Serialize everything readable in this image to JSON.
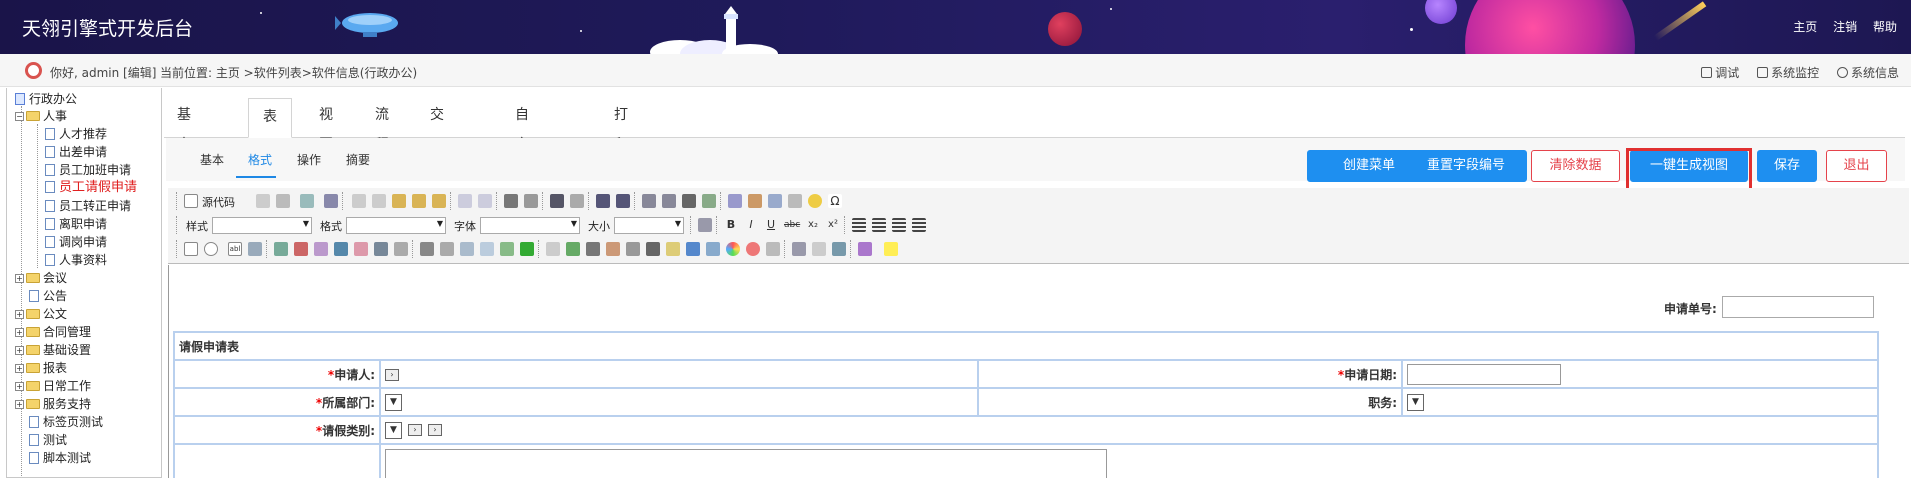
{
  "header": {
    "app_title": "天翎引擎式开发后台",
    "nav": [
      "主页",
      "注销",
      "帮助"
    ]
  },
  "infobar": {
    "greeting": "你好, admin [编辑]",
    "location": "当前位置: 主页 >软件列表>软件信息(行政办公)",
    "tools": [
      "调试",
      "系统监控",
      "系统信息"
    ]
  },
  "tree": {
    "root": "行政办公",
    "hr": "人事",
    "hr_items": [
      "人才推荐",
      "出差申请",
      "员工加班申请",
      "员工请假申请",
      "员工转正申请",
      "离职申请",
      "调岗申请",
      "人事资料"
    ],
    "active_item": "员工请假申请",
    "groups": [
      "会议",
      "公告",
      "公文",
      "合同管理",
      "基础设置",
      "报表",
      "日常工作",
      "服务支持"
    ],
    "tail": [
      "标签页测试",
      "测试",
      "脚本测试"
    ]
  },
  "main_tabs": [
    "基本信息",
    "表单",
    "视图",
    "流程",
    "交叉报表",
    "自定义报表",
    "打印"
  ],
  "main_tab_active": "表单",
  "sub_tabs": [
    "基本",
    "格式",
    "操作",
    "摘要"
  ],
  "sub_tab_active": "格式",
  "actions": {
    "create_menu": "创建菜单",
    "reset_fields": "重置字段编号",
    "clear_data": "清除数据",
    "gen_view": "一键生成视图",
    "save": "保存",
    "exit": "退出"
  },
  "toolbar": {
    "source": "源代码",
    "style": "样式",
    "format": "格式",
    "font": "字体",
    "size": "大小"
  },
  "form": {
    "no_label": "申请单号:",
    "title": "请假申请表",
    "applicant": "申请人:",
    "apply_date": "申请日期:",
    "department": "所属部门:",
    "position": "职务:",
    "leave_type": "请假类别:",
    "required_mark": "*"
  },
  "colors": {
    "brand_blue": "#1e8ff0",
    "danger_red": "#e5434b",
    "header_bg": "#1f1a5a"
  }
}
